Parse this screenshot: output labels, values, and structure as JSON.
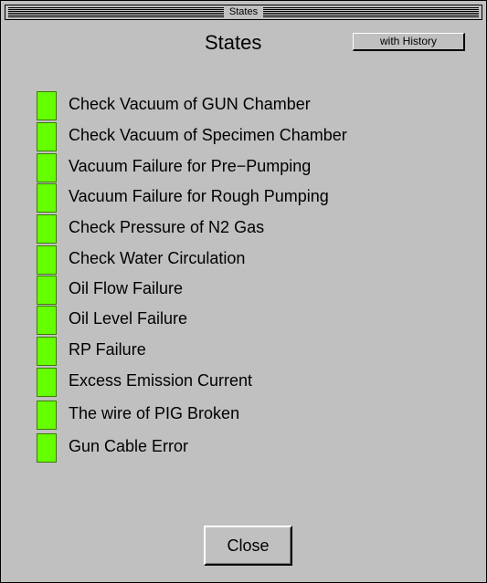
{
  "window": {
    "title": "States"
  },
  "header": {
    "title": "States",
    "history_button": "with History"
  },
  "states": [
    {
      "label": "Check Vacuum of GUN Chamber",
      "color": "#66ff00"
    },
    {
      "label": "Check Vacuum of Specimen Chamber",
      "color": "#66ff00"
    },
    {
      "label": "Vacuum Failure for Pre−Pumping",
      "color": "#66ff00"
    },
    {
      "label": "Vacuum Failure for Rough Pumping",
      "color": "#66ff00"
    },
    {
      "label": "Check Pressure of N2 Gas",
      "color": "#66ff00"
    },
    {
      "label": "Check Water Circulation",
      "color": "#66ff00"
    },
    {
      "label": "Oil Flow Failure",
      "color": "#66ff00"
    },
    {
      "label": "Oil Level Failure",
      "color": "#66ff00"
    },
    {
      "label": "RP Failure",
      "color": "#66ff00"
    },
    {
      "label": "Excess Emission Current",
      "color": "#66ff00"
    },
    {
      "label": "The wire of PIG Broken",
      "color": "#66ff00"
    },
    {
      "label": "Gun Cable Error",
      "color": "#66ff00"
    }
  ],
  "footer": {
    "close_label": "Close"
  }
}
